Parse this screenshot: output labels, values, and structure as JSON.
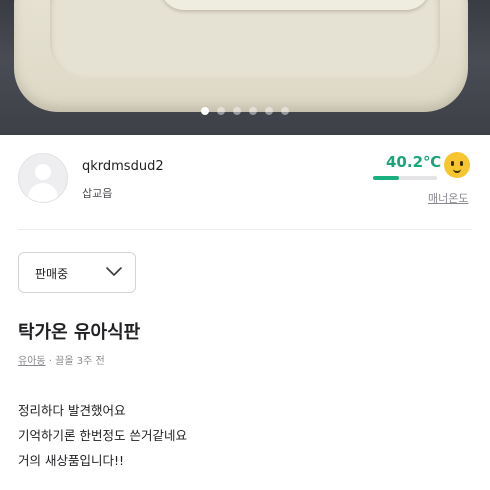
{
  "carousel": {
    "total": 6,
    "active_index": 0
  },
  "seller": {
    "nickname": "qkrdmsdud2",
    "region": "삽교읍",
    "temperature": "40.2℃",
    "temperature_value": 40.2,
    "temperature_fill_percent": 40.2,
    "temperature_label": "매너온도",
    "temperature_color": "#1aa57a",
    "face_icon": "smiling-face-icon"
  },
  "status_select": {
    "value": "판매중",
    "icon": "chevron-down-icon"
  },
  "post": {
    "title": "탁가온 유아식판",
    "category": "유아동",
    "separator": "·",
    "time": "끌올 3주 전",
    "description": [
      "정리하다 발견했어요",
      "기억하기론 한번정도 쓴거같네요",
      "거의 새상품입니다!!"
    ]
  }
}
